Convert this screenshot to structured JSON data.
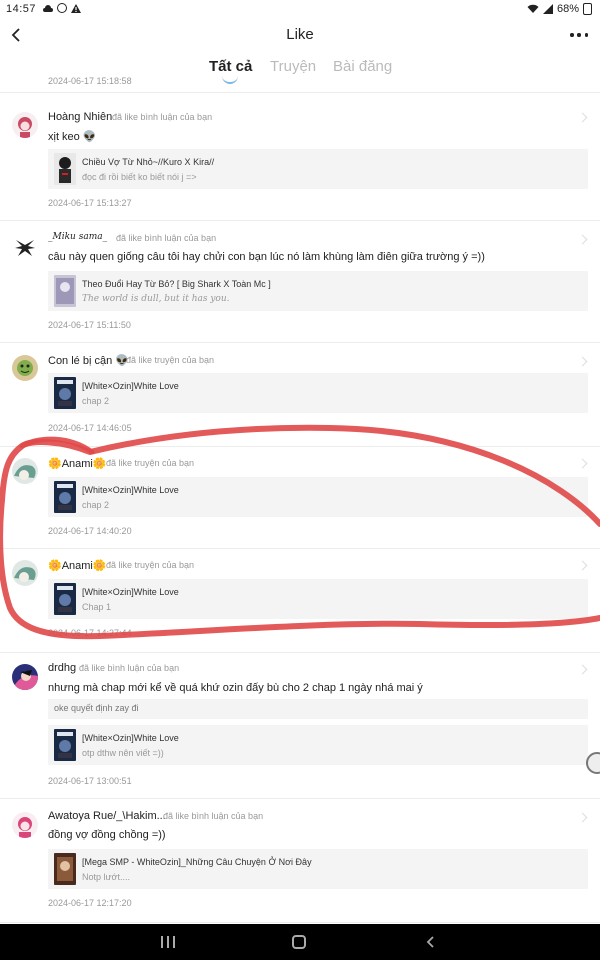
{
  "status_bar": {
    "time": "14:57",
    "battery": "68%",
    "icons": [
      "cloud-icon",
      "record-icon",
      "alert-icon",
      "wifi-icon",
      "signal-icon",
      "battery-icon"
    ]
  },
  "header": {
    "title": "Like",
    "back_icon": "chevron-left-icon",
    "more_icon": "more-dots-icon"
  },
  "tabs": [
    {
      "label": "Tất cả",
      "active": true
    },
    {
      "label": "Truyện",
      "active": false
    },
    {
      "label": "Bài đăng",
      "active": false
    }
  ],
  "feed": {
    "partial_date": "2024-06-17 15:18:58",
    "items": [
      {
        "username": "Hoàng Nhiên",
        "action": "đã like bình luận của bạn",
        "comment": "xịt keo 👽",
        "card": {
          "title": "Chiều Vợ Từ Nhỏ~//Kuro X Kira//",
          "subtitle": "đọc đi rồi biết ko biết nói j =>"
        },
        "date": "2024-06-17 15:13:27"
      },
      {
        "username": "_Miku sama_",
        "action": "đã like bình luận của bạn",
        "comment": "câu này quen giống câu tôi hay chửi con bạn lúc nó làm khùng làm điên giữa trường ý =))",
        "card": {
          "title": "Theo Đuổi Hay Từ Bỏ? [ Big Shark X Toàn Mc ]",
          "subtitle": "The world is dull, but it has you."
        },
        "date": "2024-06-17 15:11:50"
      },
      {
        "username": "Con lé bị cận 👽",
        "action": "đã like truyện của bạn",
        "card": {
          "title": "[White×Ozin]White Love",
          "subtitle": "chap 2"
        },
        "date": "2024-06-17 14:46:05"
      },
      {
        "username": "🌼Anami🌼",
        "action": "đã like truyện của bạn",
        "card": {
          "title": "[White×Ozin]White Love",
          "subtitle": "chap 2"
        },
        "date": "2024-06-17 14:40:20"
      },
      {
        "username": "🌼Anami🌼",
        "action": "đã like truyện của bạn",
        "card": {
          "title": "[White×Ozin]White Love",
          "subtitle": "Chap 1"
        },
        "date": "2024-06-17 14:27:44"
      },
      {
        "username": "drdhg",
        "action": "đã like bình luận của bạn",
        "comment": "nhưng mà chap mới kể về quá khứ ozin đấy bù cho 2 chap 1 ngày nhá mai ý",
        "quote": "oke quyết định zay đi",
        "card": {
          "title": "[White×Ozin]White Love",
          "subtitle": "otp dthw nên viết =))"
        },
        "date": "2024-06-17 13:00:51"
      },
      {
        "username": "Awatoya Rue/_\\Hakim...",
        "action": "đã like bình luận của bạn",
        "comment": "đồng vợ đồng chồng =))",
        "card": {
          "title": "[Mega SMP - WhiteOzin]_Những Câu Chuyện Ở Nơi Đây",
          "subtitle": "Notp lướt...."
        },
        "date": "2024-06-17 12:17:20"
      }
    ]
  },
  "colors": {
    "annotation_stroke": "#e04848",
    "tab_indicator": "#7ab8e8",
    "card_background": "#f4f4f4",
    "meta_text": "#999999"
  }
}
